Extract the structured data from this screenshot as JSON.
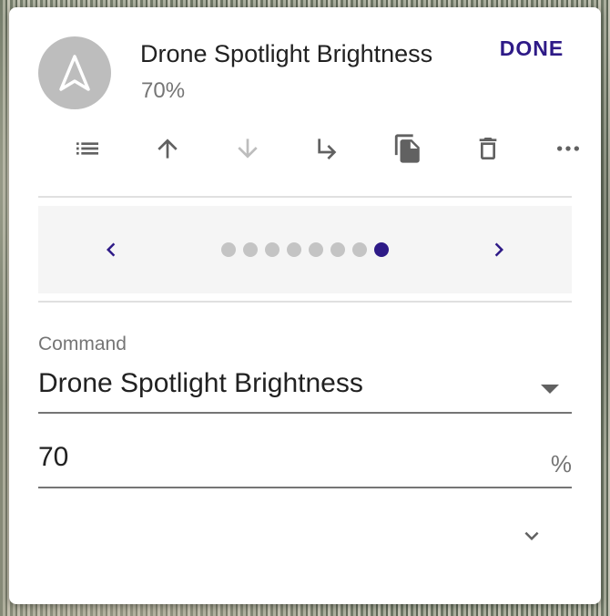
{
  "header": {
    "title": "Drone Spotlight Brightness",
    "subtitle": "70%",
    "done_label": "DONE",
    "avatar_icon": "navigation-arrow-icon"
  },
  "toolbar": {
    "items": [
      {
        "icon": "list-icon",
        "enabled": true
      },
      {
        "icon": "arrow-up-icon",
        "enabled": true
      },
      {
        "icon": "arrow-down-icon",
        "enabled": false
      },
      {
        "icon": "subdirectory-arrow-right-icon",
        "enabled": true
      },
      {
        "icon": "copy-icon",
        "enabled": true
      },
      {
        "icon": "delete-icon",
        "enabled": true
      },
      {
        "icon": "more-horizontal-icon",
        "enabled": true
      }
    ]
  },
  "pager": {
    "total": 8,
    "current": 8
  },
  "command": {
    "label": "Command",
    "value": "Drone Spotlight Brightness"
  },
  "value_field": {
    "value": "70",
    "unit": "%"
  },
  "colors": {
    "accent": "#2e1a87",
    "disabled": "#bdbdbd",
    "icon": "#616161"
  }
}
